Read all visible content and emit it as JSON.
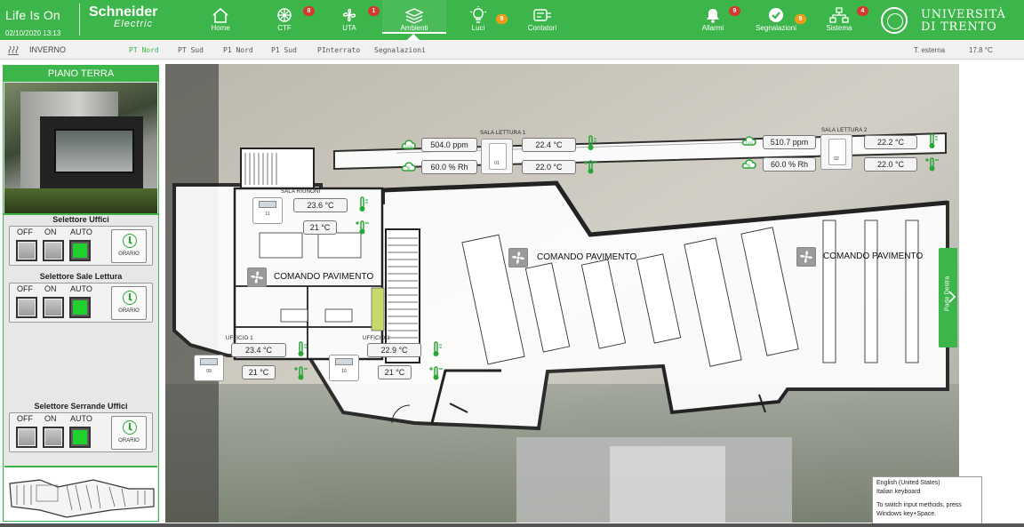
{
  "header": {
    "brand": "Life Is On",
    "datetime": "02/10/2020 13:13",
    "vendor": "Schneider",
    "vendor_sub": "Electric",
    "university_line1": "UNIVERSITÀ",
    "university_line2": "DI TRENTO",
    "nav": [
      {
        "label": "Home",
        "icon": "home-icon"
      },
      {
        "label": "CTF",
        "icon": "ctf-icon",
        "badge": "8",
        "badge_color": "#d33a2c"
      },
      {
        "label": "UTA",
        "icon": "uta-fan-icon",
        "badge": "1",
        "badge_color": "#d33a2c"
      },
      {
        "label": "Ambienti",
        "icon": "ambienti-layers-icon",
        "active": true
      },
      {
        "label": "Luci",
        "icon": "bulb-icon",
        "badge": "9",
        "badge_color": "#f29a1b"
      },
      {
        "label": "Contatori",
        "icon": "meter-icon"
      },
      {
        "label": "Allarmi",
        "icon": "bell-icon",
        "badge": "9",
        "badge_color": "#d33a2c"
      },
      {
        "label": "Segnalazioni",
        "icon": "check-icon",
        "badge": "9",
        "badge_color": "#f29a1b"
      },
      {
        "label": "Sistema",
        "icon": "network-icon",
        "badge": "4",
        "badge_color": "#d33a2c"
      }
    ]
  },
  "subbar": {
    "season": "INVERNO",
    "tabs": [
      "PT Nord",
      "PT Sud",
      "P1 Nord",
      "P1 Sud",
      "PInterrato",
      "Segnalazioni"
    ],
    "active_tab": "PT Nord",
    "outdoor_label": "T. esterna",
    "outdoor_value": "17.8 °C"
  },
  "left_panel": {
    "title": "PIANO TERRA",
    "selectors": [
      {
        "title": "Selettore Uffici",
        "labels": [
          "OFF",
          "ON",
          "AUTO"
        ],
        "selected": "AUTO",
        "schedule_label": "ORARIO"
      },
      {
        "title": "Selettore Sale Lettura",
        "labels": [
          "OFF",
          "ON",
          "AUTO"
        ],
        "selected": "AUTO",
        "schedule_label": "ORARIO"
      },
      {
        "title": "Selettore Serrande Uffici",
        "labels": [
          "OFF",
          "ON",
          "AUTO"
        ],
        "selected": "AUTO",
        "schedule_label": "ORARIO"
      }
    ]
  },
  "rooms": {
    "sala_lettura_1": {
      "title": "SALA LETTURA 1",
      "co2": "504.0 ppm",
      "rh": "60.0 % Rh",
      "temp": "22.4 °C",
      "setpoint": "22.0 °C",
      "sensor_id": "01"
    },
    "sala_lettura_2": {
      "title": "SALA LETTURA 2",
      "co2": "510.7 ppm",
      "rh": "60.0 % Rh",
      "temp": "22.2 °C",
      "setpoint": "22.0 °C",
      "sensor_id": "02"
    },
    "sala_riunioni": {
      "title": "SALA RIUNONI",
      "temp": "23.6 °C",
      "setpoint": "21 °C",
      "thermostat_id": "11"
    },
    "ufficio_1": {
      "title": "UFFICIO 1",
      "temp": "23.4 °C",
      "setpoint": "21 °C",
      "thermostat_id": "09"
    },
    "ufficio_2": {
      "title": "UFFICIO 2",
      "temp": "22.9 °C",
      "setpoint": "21 °C",
      "thermostat_id": "10"
    }
  },
  "floor_commands": [
    "COMANDO PAVIMENTO",
    "COMANDO PAVIMENTO",
    "COMANDO PAVIMENTO"
  ],
  "side_tab": "Parte Destra",
  "ime_tooltip": {
    "line1": "English (United States)",
    "line2": "Italian keyboard",
    "line3": "To switch input methods, press",
    "line4": "Windows key+Space."
  },
  "colors": {
    "brand_green": "#3cb54a",
    "badge_red": "#d33a2c",
    "badge_orange": "#f29a1b",
    "status_on": "#1ed12f"
  }
}
